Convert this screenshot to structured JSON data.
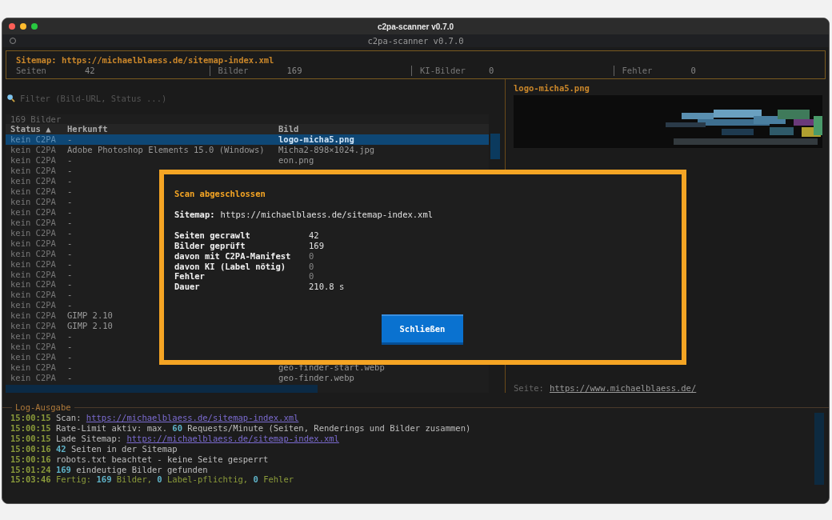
{
  "window": {
    "title": "c2pa-scanner v0.7.0"
  },
  "app_header": {
    "title": "c2pa-scanner v0.7.0"
  },
  "summary": {
    "sitemap": "Sitemap: https://michaelblaess.de/sitemap-index.xml",
    "stats": [
      {
        "label": "Seiten",
        "value": "42"
      },
      {
        "label": "Bilder",
        "value": "169"
      },
      {
        "label": "KI-Bilder",
        "value": "0"
      },
      {
        "label": "Fehler",
        "value": "0"
      }
    ]
  },
  "filter": {
    "placeholder": "Filter (Bild-URL, Status ...)"
  },
  "table": {
    "count": "169 Bilder",
    "columns": [
      "Status ▲",
      "Herkunft",
      "Bild"
    ],
    "rows": [
      {
        "status": "kein C2PA",
        "origin": "-",
        "image": "logo-micha5.png",
        "selected": true
      },
      {
        "status": "kein C2PA",
        "origin": "Adobe Photoshop Elements 15.0 (Windows)",
        "image": "Micha2-898×1024.jpg",
        "selected": false
      },
      {
        "status": "kein C2PA",
        "origin": "-",
        "image": "eon.png",
        "selected": false
      },
      {
        "status": "kein C2PA",
        "origin": "-",
        "selected": false
      },
      {
        "status": "kein C2PA",
        "origin": "-",
        "selected": false
      },
      {
        "status": "kein C2PA",
        "origin": "-",
        "selected": false
      },
      {
        "status": "kein C2PA",
        "origin": "-",
        "selected": false
      },
      {
        "status": "kein C2PA",
        "origin": "-",
        "selected": false
      },
      {
        "status": "kein C2PA",
        "origin": "-",
        "selected": false
      },
      {
        "status": "kein C2PA",
        "origin": "-",
        "selected": false
      },
      {
        "status": "kein C2PA",
        "origin": "-",
        "selected": false
      },
      {
        "status": "kein C2PA",
        "origin": "-",
        "selected": false
      },
      {
        "status": "kein C2PA",
        "origin": "-",
        "selected": false
      },
      {
        "status": "kein C2PA",
        "origin": "-",
        "selected": false
      },
      {
        "status": "kein C2PA",
        "origin": "-",
        "selected": false
      },
      {
        "status": "kein C2PA",
        "origin": "-",
        "selected": false
      },
      {
        "status": "kein C2PA",
        "origin": "-",
        "selected": false
      },
      {
        "status": "kein C2PA",
        "origin": "GIMP 2.10",
        "selected": false
      },
      {
        "status": "kein C2PA",
        "origin": "GIMP 2.10",
        "selected": false
      },
      {
        "status": "kein C2PA",
        "origin": "-",
        "selected": false
      },
      {
        "status": "kein C2PA",
        "origin": "-",
        "selected": false
      },
      {
        "status": "kein C2PA",
        "origin": "-",
        "selected": false
      },
      {
        "status": "kein C2PA",
        "origin": "-",
        "image": "geo-finder-start.webp",
        "selected": false
      },
      {
        "status": "kein C2PA",
        "origin": "-",
        "image": "geo-finder.webp",
        "selected": false
      }
    ]
  },
  "preview": {
    "title": "logo-micha5.png",
    "page_label": "Seite:",
    "page_link": "https://www.michaelblaess.de/"
  },
  "log": {
    "title": "Log-Ausgabe",
    "lines": [
      {
        "time": "15:00:15",
        "kind": "info",
        "parts": [
          {
            "kind": "text",
            "text": "Scan: "
          },
          {
            "kind": "link",
            "text": "https://michaelblaess.de/sitemap-index.xml"
          }
        ]
      },
      {
        "time": "15:00:15",
        "kind": "info",
        "parts": [
          {
            "kind": "text",
            "text": "Rate-Limit aktiv: max. "
          },
          {
            "kind": "num",
            "text": "60"
          },
          {
            "kind": "text",
            "text": " Requests/Minute (Seiten, Renderings und Bilder zusammen)"
          }
        ]
      },
      {
        "time": "15:00:15",
        "kind": "info",
        "parts": [
          {
            "kind": "text",
            "text": "Lade Sitemap: "
          },
          {
            "kind": "link",
            "text": "https://michaelblaess.de/sitemap-index.xml"
          }
        ]
      },
      {
        "time": "15:00:16",
        "kind": "info",
        "parts": [
          {
            "kind": "num",
            "text": "42"
          },
          {
            "kind": "text",
            "text": " Seiten in der Sitemap"
          }
        ]
      },
      {
        "time": "15:00:16",
        "kind": "info",
        "parts": [
          {
            "kind": "text",
            "text": "robots.txt beachtet - keine Seite gesperrt"
          }
        ]
      },
      {
        "time": "15:01:24",
        "kind": "info",
        "parts": [
          {
            "kind": "num",
            "text": "169"
          },
          {
            "kind": "text",
            "text": " eindeutige Bilder gefunden"
          }
        ]
      },
      {
        "time": "15:03:46",
        "kind": "done",
        "parts": [
          {
            "kind": "text",
            "text": "Fertig: "
          },
          {
            "kind": "num",
            "text": "169"
          },
          {
            "kind": "text",
            "text": " Bilder, "
          },
          {
            "kind": "num",
            "text": "0"
          },
          {
            "kind": "text",
            "text": " Label-pflichtig, "
          },
          {
            "kind": "num",
            "text": "0"
          },
          {
            "kind": "text",
            "text": " Fehler"
          }
        ]
      }
    ]
  },
  "dialog": {
    "title": "Scan abgeschlossen",
    "sitemap_label": "Sitemap:",
    "sitemap_value": "https://michaelblaess.de/sitemap-index.xml",
    "stats": [
      {
        "label": "Seiten gecrawlt",
        "value": "42",
        "muted": false
      },
      {
        "label": "Bilder geprüft",
        "value": "169",
        "muted": false
      },
      {
        "label": "davon mit C2PA-Manifest",
        "value": "0",
        "muted": true
      },
      {
        "label": "davon KI (Label nötig)",
        "value": "0",
        "muted": true
      },
      {
        "label": "Fehler",
        "value": "0",
        "muted": true
      },
      {
        "label": "Dauer",
        "value": "210.8 s",
        "muted": false
      }
    ],
    "button": "Schließen"
  }
}
